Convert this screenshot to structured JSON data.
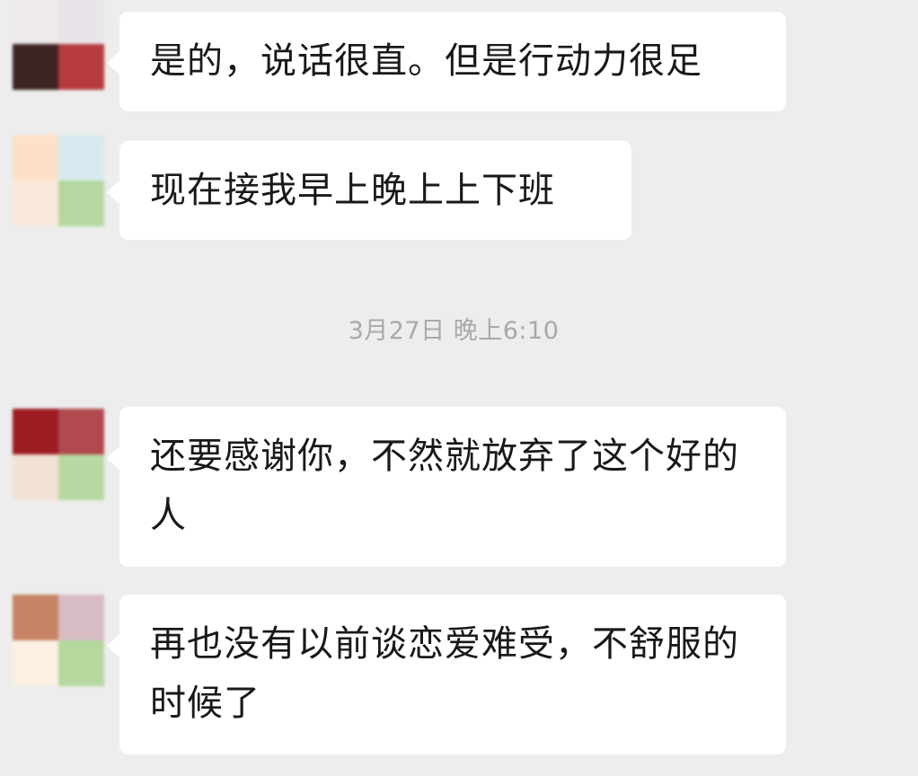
{
  "chat": {
    "background": "#ededed",
    "messages": [
      {
        "text": "是的，说话很直。但是行动力很足",
        "avatar_colors": [
          "#f0eaea",
          "#e9e4ea",
          "#3d2322",
          "#b53b3d"
        ]
      },
      {
        "text": "现在接我早上晚上上下班",
        "avatar_colors": [
          "#fce1c8",
          "#d8eaf0",
          "#fbe8dc",
          "#b4d89f"
        ]
      },
      {
        "text": "还要感谢你，不然就放弃了这个好的人",
        "avatar_colors": [
          "#9c1c22",
          "#b04a4f",
          "#f2e2d6",
          "#b7d9a1"
        ]
      },
      {
        "text": "再也没有以前谈恋爱难受，不舒服的时候了",
        "avatar_colors": [
          "#c88466",
          "#d7bcc4",
          "#fbf0e2",
          "#b4d89d"
        ]
      }
    ],
    "timestamp": "3月27日 晚上6:10"
  }
}
